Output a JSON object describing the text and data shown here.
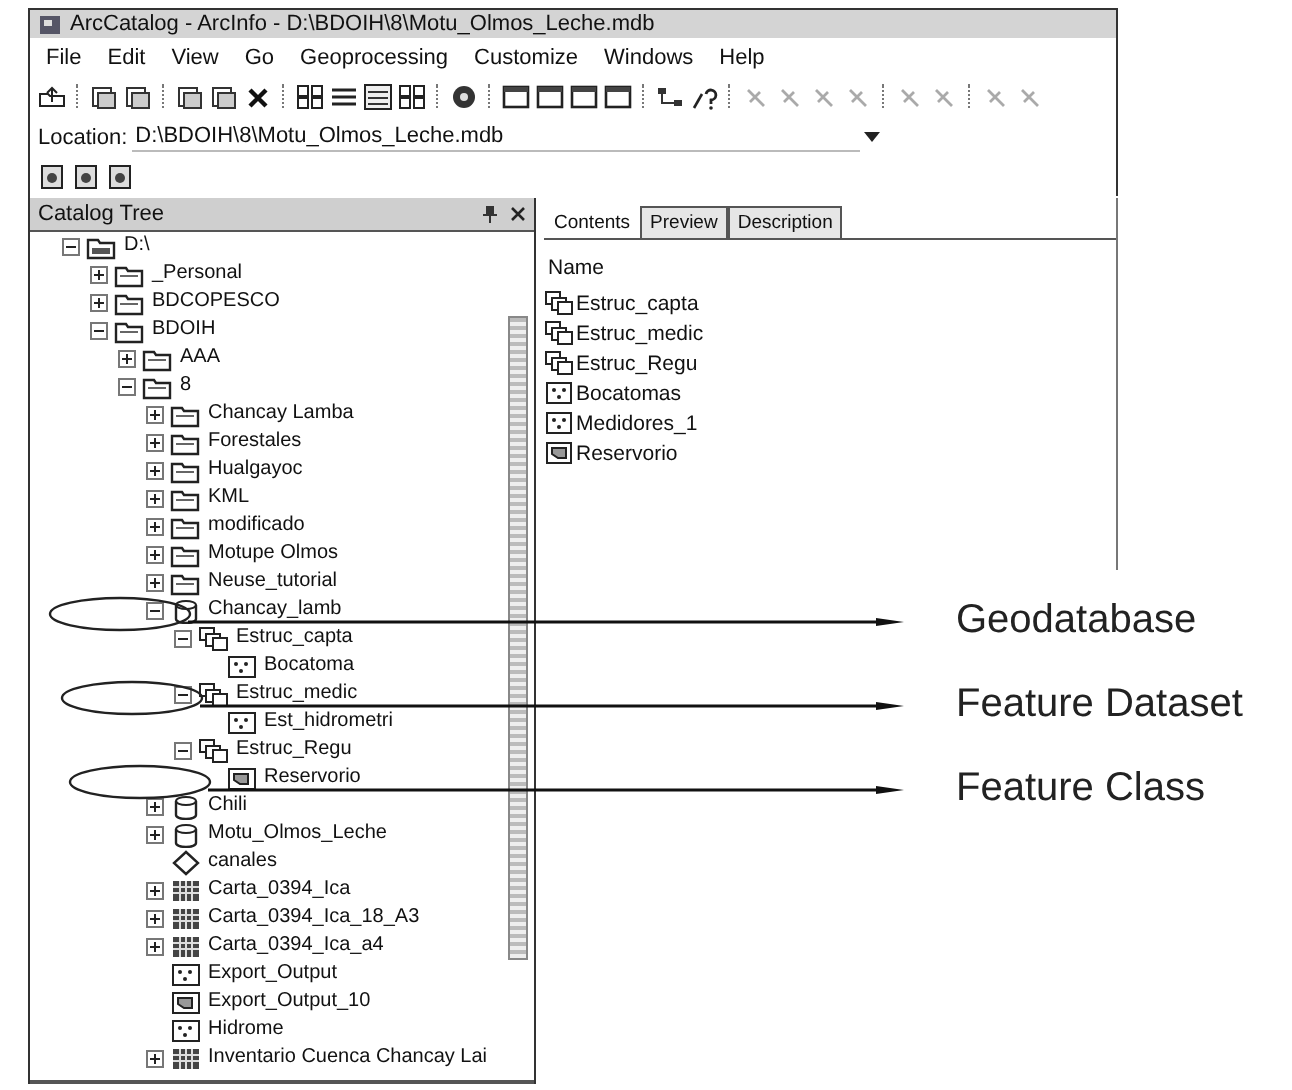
{
  "window": {
    "title": "ArcCatalog - ArcInfo - D:\\BDOIH\\8\\Motu_Olmos_Leche.mdb"
  },
  "menu": [
    "File",
    "Edit",
    "View",
    "Go",
    "Geoprocessing",
    "Customize",
    "Windows",
    "Help"
  ],
  "location": {
    "label": "Location:",
    "value": "D:\\BDOIH\\8\\Motu_Olmos_Leche.mdb"
  },
  "catalog_tree": {
    "title": "Catalog Tree",
    "items": [
      {
        "name": "D:\\",
        "kind": "drive",
        "expanded": true,
        "children": [
          {
            "name": "_Personal",
            "kind": "folder",
            "expanded": false
          },
          {
            "name": "BDCOPESCO",
            "kind": "folder",
            "expanded": false
          },
          {
            "name": "BDOIH",
            "kind": "folder",
            "expanded": true,
            "children": [
              {
                "name": "AAA",
                "kind": "folder",
                "expanded": false
              },
              {
                "name": "8",
                "kind": "folder",
                "expanded": true,
                "children": [
                  {
                    "name": "Chancay Lamba",
                    "kind": "folder",
                    "expanded": false
                  },
                  {
                    "name": "Forestales",
                    "kind": "folder",
                    "expanded": false
                  },
                  {
                    "name": "Hualgayoc",
                    "kind": "folder",
                    "expanded": false
                  },
                  {
                    "name": "KML",
                    "kind": "folder",
                    "expanded": false
                  },
                  {
                    "name": "modificado",
                    "kind": "folder",
                    "expanded": false
                  },
                  {
                    "name": "Motupe Olmos",
                    "kind": "folder",
                    "expanded": false
                  },
                  {
                    "name": "Neuse_tutorial",
                    "kind": "folder",
                    "expanded": false
                  },
                  {
                    "name": "Chancay_lamb",
                    "kind": "geodatabase",
                    "expanded": true,
                    "children": [
                      {
                        "name": "Estruc_capta",
                        "kind": "dataset",
                        "expanded": true,
                        "children": [
                          {
                            "name": "Bocatoma",
                            "kind": "point"
                          }
                        ]
                      },
                      {
                        "name": "Estruc_medic",
                        "kind": "dataset",
                        "expanded": true,
                        "children": [
                          {
                            "name": "Est_hidrometri",
                            "kind": "point"
                          }
                        ]
                      },
                      {
                        "name": "Estruc_Regu",
                        "kind": "dataset",
                        "expanded": true,
                        "children": [
                          {
                            "name": "Reservorio",
                            "kind": "polygon"
                          }
                        ]
                      }
                    ]
                  },
                  {
                    "name": "Chili",
                    "kind": "geodatabase",
                    "expanded": false
                  },
                  {
                    "name": "Motu_Olmos_Leche",
                    "kind": "geodatabase",
                    "expanded": false
                  },
                  {
                    "name": "canales",
                    "kind": "line"
                  },
                  {
                    "name": "Carta_0394_Ica",
                    "kind": "raster",
                    "expanded": false
                  },
                  {
                    "name": "Carta_0394_Ica_18_A3",
                    "kind": "raster",
                    "expanded": false
                  },
                  {
                    "name": "Carta_0394_Ica_a4",
                    "kind": "raster",
                    "expanded": false
                  },
                  {
                    "name": "Export_Output",
                    "kind": "point"
                  },
                  {
                    "name": "Export_Output_10",
                    "kind": "polygon"
                  },
                  {
                    "name": "Hidrome",
                    "kind": "point"
                  },
                  {
                    "name": "Inventario Cuenca Chancay Lai",
                    "kind": "raster",
                    "expanded": false
                  }
                ]
              }
            ]
          }
        ]
      }
    ]
  },
  "contents": {
    "tabs": [
      {
        "label": "Contents",
        "selected": true
      },
      {
        "label": "Preview",
        "selected": false
      },
      {
        "label": "Description",
        "selected": false
      }
    ],
    "column": "Name",
    "items": [
      {
        "name": "Estruc_capta",
        "kind": "dataset"
      },
      {
        "name": "Estruc_medic",
        "kind": "dataset"
      },
      {
        "name": "Estruc_Regu",
        "kind": "dataset"
      },
      {
        "name": "Bocatomas",
        "kind": "point"
      },
      {
        "name": "Medidores_1",
        "kind": "point"
      },
      {
        "name": "Reservorio",
        "kind": "polygon"
      }
    ]
  },
  "annotations": [
    {
      "label": "Geodatabase"
    },
    {
      "label": "Feature Dataset"
    },
    {
      "label": "Feature Class"
    }
  ]
}
